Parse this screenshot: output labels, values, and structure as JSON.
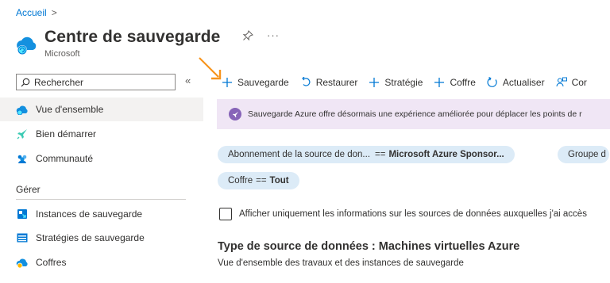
{
  "breadcrumb": {
    "root": "Accueil",
    "separator": ">"
  },
  "header": {
    "title": "Centre de sauvegarde",
    "subtitle": "Microsoft",
    "pin_icon": "pin-icon",
    "more_label": "···"
  },
  "sidebar": {
    "search_placeholder": "Rechercher",
    "collapse_label": "«",
    "items": [
      {
        "label": "Vue d'ensemble",
        "icon": "cloud-icon",
        "active": true
      },
      {
        "label": "Bien démarrer",
        "icon": "rocket-icon"
      },
      {
        "label": "Communauté",
        "icon": "community-icon"
      }
    ],
    "section_label": "Gérer",
    "manage_items": [
      {
        "label": "Instances de sauvegarde",
        "icon": "instances-icon"
      },
      {
        "label": "Stratégies de sauvegarde",
        "icon": "policies-icon"
      },
      {
        "label": "Coffres",
        "icon": "vault-icon"
      }
    ]
  },
  "toolbar": {
    "backup_label": "Sauvegarde",
    "restore_label": "Restaurer",
    "policy_label": "Stratégie",
    "vault_label": "Coffre",
    "refresh_label": "Actualiser",
    "more_label": "Cor"
  },
  "banner": {
    "text": "Sauvegarde Azure offre désormais une expérience améliorée pour déplacer les points de r"
  },
  "filters": {
    "subscription_key": "Abonnement de la source de don...",
    "subscription_op": "==",
    "subscription_value": "Microsoft Azure Sponsor...",
    "group_key": "Groupe d",
    "vault_key": "Coffre",
    "vault_op": "==",
    "vault_value": "Tout"
  },
  "checkbox": {
    "label": "Afficher uniquement les informations sur les sources de données auxquelles j'ai accès",
    "checked": false
  },
  "content": {
    "section_title": "Type de source de données : Machines virtuelles Azure",
    "section_subtitle": "Vue d'ensemble des travaux et des instances de sauvegarde"
  },
  "colors": {
    "accent": "#0078d4",
    "banner_bg": "#f0e6f5",
    "pill_bg": "#dcebf7",
    "arrow": "#f7941d"
  }
}
